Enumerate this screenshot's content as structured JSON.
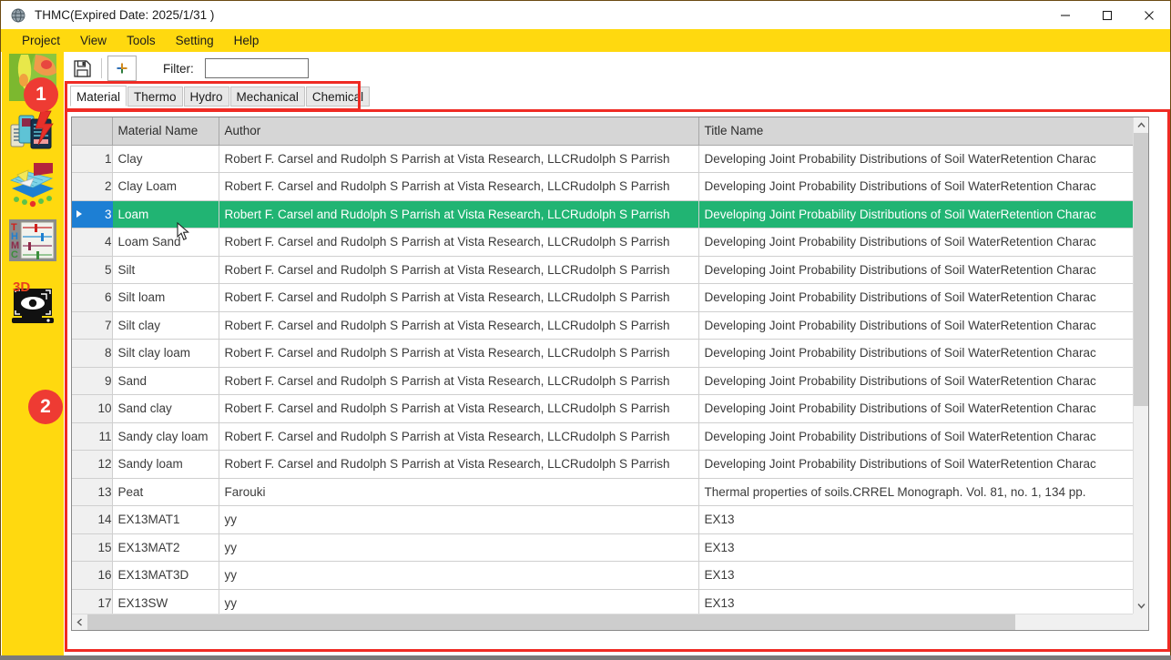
{
  "window": {
    "title": "THMC(Expired Date: 2025/1/31 )",
    "app_icon": "globe-icon",
    "controls": {
      "minimize": "minimize-icon",
      "maximize": "maximize-icon",
      "close": "close-icon"
    }
  },
  "menu": {
    "items": [
      {
        "label": "Project"
      },
      {
        "label": "View"
      },
      {
        "label": "Tools"
      },
      {
        "label": "Setting"
      },
      {
        "label": "Help"
      }
    ]
  },
  "sidebar": {
    "background_color": "#ffd90f",
    "items": [
      {
        "name": "region-map-icon",
        "label": "Region"
      },
      {
        "name": "database-icon",
        "label": "Database"
      },
      {
        "name": "mesh-icon",
        "label": "Mesh"
      },
      {
        "name": "thmc-sliders-icon",
        "label": "THMC"
      },
      {
        "name": "view-3d-icon",
        "label": "3D View"
      }
    ]
  },
  "annotations": {
    "badges": [
      {
        "number": "1",
        "target": "database-icon",
        "color": "#ee3b33"
      },
      {
        "number": "2",
        "target": "material-grid",
        "color": "#ee3b33"
      }
    ],
    "boxes": [
      {
        "name": "tab-strip-highlight",
        "color": "#ef2b24"
      },
      {
        "name": "grid-highlight",
        "color": "#ef2b24"
      }
    ]
  },
  "toolbar": {
    "save_icon": "floppy-disk-save-icon",
    "add_label": "+",
    "filter_label": "Filter:",
    "filter_value": "",
    "filter_placeholder": ""
  },
  "tabs": [
    {
      "label": "Material",
      "active": true
    },
    {
      "label": "Thermo",
      "active": false
    },
    {
      "label": "Hydro",
      "active": false
    },
    {
      "label": "Mechanical",
      "active": false
    },
    {
      "label": "Chemical",
      "active": false
    }
  ],
  "grid": {
    "columns": [
      {
        "key": "index",
        "label": ""
      },
      {
        "key": "material_name",
        "label": "Material Name"
      },
      {
        "key": "author",
        "label": "Author"
      },
      {
        "key": "title_name",
        "label": "Title Name"
      }
    ],
    "selected_row_index": 3,
    "selected_row_color": "#21b473",
    "row_indicator_selected_color": "#1d7fd4",
    "rows": [
      {
        "index": "1",
        "material_name": "Clay",
        "author": "Robert F. Carsel and Rudolph S Parrish at Vista Research, LLCRudolph S Parrish",
        "title_name": "Developing Joint Probability Distributions of Soil WaterRetention Charac"
      },
      {
        "index": "2",
        "material_name": "Clay Loam",
        "author": "Robert F. Carsel and Rudolph S Parrish at Vista Research, LLCRudolph S Parrish",
        "title_name": "Developing Joint Probability Distributions of Soil WaterRetention Charac"
      },
      {
        "index": "3",
        "material_name": "Loam",
        "author": "Robert F. Carsel and Rudolph S Parrish at Vista Research, LLCRudolph S Parrish",
        "title_name": "Developing Joint Probability Distributions of Soil WaterRetention Charac"
      },
      {
        "index": "4",
        "material_name": "Loam Sand",
        "author": "Robert F. Carsel and Rudolph S Parrish at Vista Research, LLCRudolph S Parrish",
        "title_name": "Developing Joint Probability Distributions of Soil WaterRetention Charac"
      },
      {
        "index": "5",
        "material_name": "Silt",
        "author": "Robert F. Carsel and Rudolph S Parrish at Vista Research, LLCRudolph S Parrish",
        "title_name": "Developing Joint Probability Distributions of Soil WaterRetention Charac"
      },
      {
        "index": "6",
        "material_name": "Silt loam",
        "author": "Robert F. Carsel and Rudolph S Parrish at Vista Research, LLCRudolph S Parrish",
        "title_name": "Developing Joint Probability Distributions of Soil WaterRetention Charac"
      },
      {
        "index": "7",
        "material_name": "Silt clay",
        "author": "Robert F. Carsel and Rudolph S Parrish at Vista Research, LLCRudolph S Parrish",
        "title_name": "Developing Joint Probability Distributions of Soil WaterRetention Charac"
      },
      {
        "index": "8",
        "material_name": "Silt clay loam",
        "author": "Robert F. Carsel and Rudolph S Parrish at Vista Research, LLCRudolph S Parrish",
        "title_name": "Developing Joint Probability Distributions of Soil WaterRetention Charac"
      },
      {
        "index": "9",
        "material_name": "Sand",
        "author": "Robert F. Carsel and Rudolph S Parrish at Vista Research, LLCRudolph S Parrish",
        "title_name": "Developing Joint Probability Distributions of Soil WaterRetention Charac"
      },
      {
        "index": "10",
        "material_name": "Sand clay",
        "author": "Robert F. Carsel and Rudolph S Parrish at Vista Research, LLCRudolph S Parrish",
        "title_name": "Developing Joint Probability Distributions of Soil WaterRetention Charac"
      },
      {
        "index": "11",
        "material_name": "Sandy clay loam",
        "author": "Robert F. Carsel and Rudolph S Parrish at Vista Research, LLCRudolph S Parrish",
        "title_name": "Developing Joint Probability Distributions of Soil WaterRetention Charac"
      },
      {
        "index": "12",
        "material_name": "Sandy loam",
        "author": "Robert F. Carsel and Rudolph S Parrish at Vista Research, LLCRudolph S Parrish",
        "title_name": "Developing Joint Probability Distributions of Soil WaterRetention Charac"
      },
      {
        "index": "13",
        "material_name": "Peat",
        "author": "Farouki",
        "title_name": "Thermal properties of soils.CRREL Monograph. Vol. 81, no. 1, 134 pp."
      },
      {
        "index": "14",
        "material_name": "EX13MAT1",
        "author": "yy",
        "title_name": "EX13"
      },
      {
        "index": "15",
        "material_name": "EX13MAT2",
        "author": "yy",
        "title_name": "EX13"
      },
      {
        "index": "16",
        "material_name": "EX13MAT3D",
        "author": "yy",
        "title_name": "EX13"
      },
      {
        "index": "17",
        "material_name": "EX13SW",
        "author": "yy",
        "title_name": "EX13"
      },
      {
        "index": "",
        "material_name": "",
        "author": "",
        "title_name": ""
      }
    ]
  },
  "scrollbars": {
    "vertical": {
      "up_icon": "chevron-up-icon",
      "down_icon": "chevron-down-icon"
    },
    "horizontal": {
      "left_icon": "chevron-left-icon",
      "right_icon": "chevron-right-icon"
    }
  }
}
